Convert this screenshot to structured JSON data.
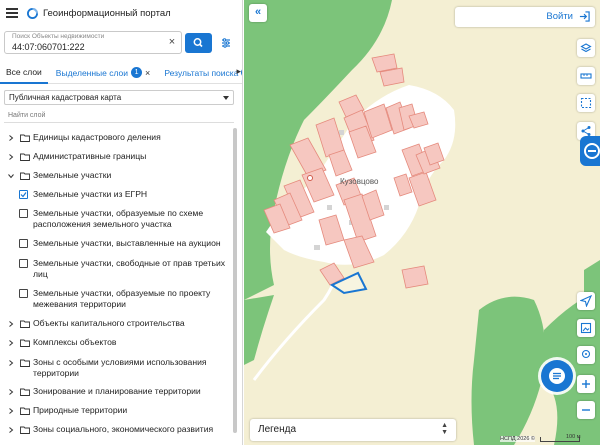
{
  "app": {
    "title": "Геоинформационный портал"
  },
  "search": {
    "placeholder": "Поиск Объекты недвижимости",
    "value": "44:07:060701:222"
  },
  "tabs": [
    {
      "label": "Все слои"
    },
    {
      "label": "Выделенные слои",
      "badge": "1"
    },
    {
      "label": "Результаты поиска",
      "badge": "1"
    }
  ],
  "basemap": {
    "selected": "Публичная кадастровая карта"
  },
  "layer_filter": {
    "placeholder": "Найти слой"
  },
  "layers": [
    {
      "label": "Единицы кадастрового деления",
      "kind": "folder",
      "expanded": false
    },
    {
      "label": "Административные границы",
      "kind": "folder",
      "expanded": false
    },
    {
      "label": "Земельные участки",
      "kind": "folder",
      "expanded": true
    },
    {
      "label": "Земельные участки из ЕГРН",
      "kind": "checkbox",
      "checked": true
    },
    {
      "label": "Земельные участки, образуемые по схеме расположения земельного участка",
      "kind": "checkbox",
      "checked": false
    },
    {
      "label": "Земельные участки, выставленные на аукцион",
      "kind": "checkbox",
      "checked": false
    },
    {
      "label": "Земельные участки, свободные от прав третьих лиц",
      "kind": "checkbox",
      "checked": false
    },
    {
      "label": "Земельные участки, образуемые по проекту межевания территории",
      "kind": "checkbox",
      "checked": false
    },
    {
      "label": "Объекты капитального строительства",
      "kind": "folder",
      "expanded": false
    },
    {
      "label": "Комплексы объектов",
      "kind": "folder",
      "expanded": false
    },
    {
      "label": "Зоны с особыми условиями использования территории",
      "kind": "folder",
      "expanded": false
    },
    {
      "label": "Зонирование и планирование территории",
      "kind": "folder",
      "expanded": false
    },
    {
      "label": "Природные территории",
      "kind": "folder",
      "expanded": false
    },
    {
      "label": "Зоны социального, экономического развития",
      "kind": "folder",
      "expanded": false
    }
  ],
  "map": {
    "login_label": "Войти",
    "place_label": "Кузовцово",
    "legend_label": "Легенда",
    "attribution": "НСПД 2026 ©",
    "scale_label": "100 м"
  },
  "colors": {
    "accent": "#1976d2",
    "forest": "#7cc47a",
    "parcel_fill": "#f6c7c0",
    "parcel_stroke": "#e58a7d",
    "selected_parcel": "#1976d2"
  }
}
